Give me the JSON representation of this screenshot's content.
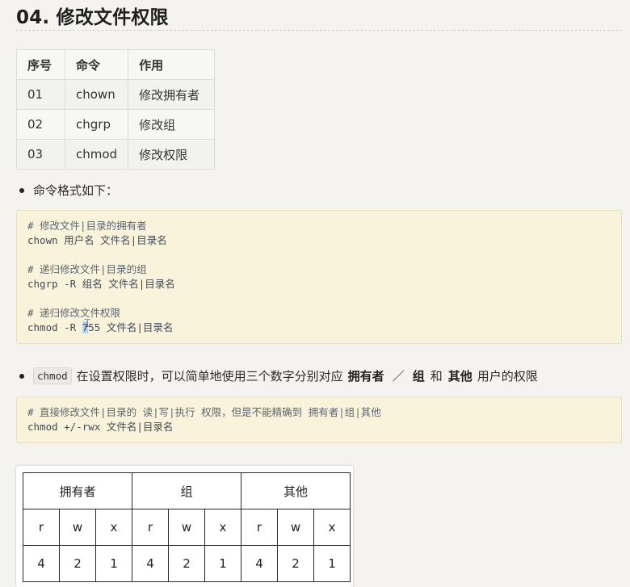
{
  "title": "04. 修改文件权限",
  "cmd_table": {
    "headers": [
      "序号",
      "命令",
      "作用"
    ],
    "rows": [
      [
        "01",
        "chown",
        "修改拥有者"
      ],
      [
        "02",
        "chgrp",
        "修改组"
      ],
      [
        "03",
        "chmod",
        "修改权限"
      ]
    ]
  },
  "bullet1": "命令格式如下：",
  "code1": {
    "l1": "# 修改文件|目录的拥有者",
    "l2": "chown 用户名 文件名|目录名",
    "l3": "# 递归修改文件|目录的组",
    "l4": "chgrp -R 组名 文件名|目录名",
    "l5": "# 递归修改文件权限",
    "l6a": "chmod -R ",
    "l6sel": "7",
    "l6b": "55 文件名|目录名"
  },
  "bullet2": {
    "code": "chmod",
    "text1": "在设置权限时，可以简单地使用三个数字分别对应",
    "owner": "拥有者",
    "slash": "／",
    "group": "组",
    "and": "和",
    "other": "其他",
    "text2": "用户的权限"
  },
  "code2": {
    "l1": "# 直接修改文件|目录的 读|写|执行 权限，但是不能精确到 拥有者|组|其他",
    "l2": "chmod +/-rwx 文件名|目录名"
  },
  "perm_table": {
    "groups": [
      "拥有者",
      "组",
      "其他"
    ],
    "rwx": [
      "r",
      "w",
      "x",
      "r",
      "w",
      "x",
      "r",
      "w",
      "x"
    ],
    "values": [
      "4",
      "2",
      "1",
      "4",
      "2",
      "1",
      "4",
      "2",
      "1"
    ]
  }
}
